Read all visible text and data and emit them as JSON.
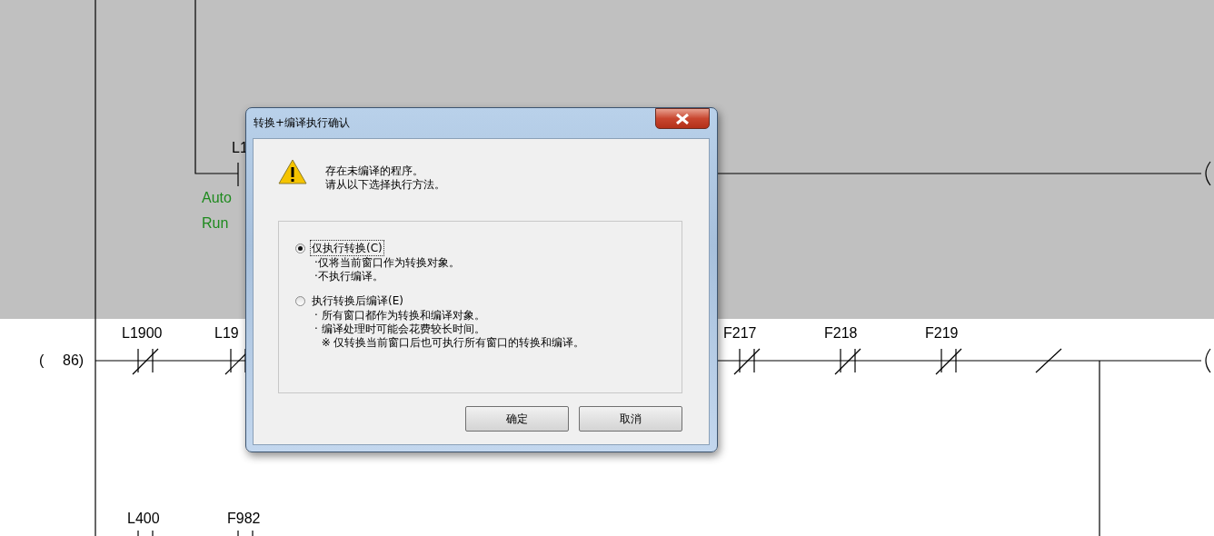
{
  "ladder": {
    "top_rung": {
      "contact": "L1",
      "comment_lines": [
        "Auto",
        "Run"
      ]
    },
    "rung": {
      "step_open": "(",
      "step_number": "86)",
      "contacts": [
        "L1900",
        "L19",
        "F217",
        "F218",
        "F219"
      ]
    },
    "next_rung": {
      "contacts": [
        "L400",
        "F982"
      ]
    }
  },
  "dialog": {
    "title": "转换+编译执行确认",
    "message": [
      "存在未编译的程序。",
      "请从以下选择执行方法。"
    ],
    "options": [
      {
        "label": "仅执行转换(C)",
        "selected": true,
        "notes": [
          "·仅将当前窗口作为转换对象。",
          "·不执行编译。"
        ]
      },
      {
        "label": "执行转换后编译(E)",
        "selected": false,
        "notes": [
          "· 所有窗口都作为转换和编译对象。",
          "· 编译处理时可能会花费较长时间。",
          "  ※ 仅转换当前窗口后也可执行所有窗口的转换和编译。"
        ]
      }
    ],
    "buttons": [
      "确定",
      "取消"
    ]
  }
}
